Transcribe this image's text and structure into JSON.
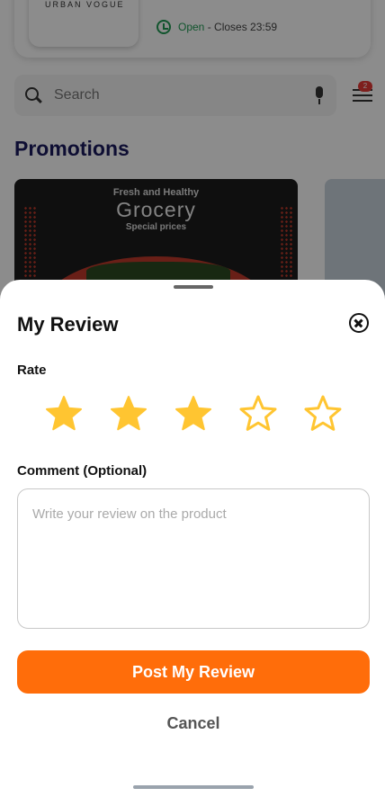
{
  "background": {
    "store": {
      "brand_text": "URBAN VOGUE",
      "hours_status": "Open",
      "hours_detail": " - Closes 23:59"
    },
    "search": {
      "placeholder": "Search",
      "filter_badge": "2"
    },
    "promotions": {
      "title": "Promotions",
      "card": {
        "top_line": "Fresh and Healthy",
        "headline": "Grocery",
        "subline": "Special prices"
      }
    }
  },
  "review_sheet": {
    "title": "My Review",
    "rate_label": "Rate",
    "rating": 3,
    "max_rating": 5,
    "star_fill_color": "#FFC531",
    "comment_label": "Comment (Optional)",
    "comment_placeholder": "Write your review on the product",
    "comment_value": "",
    "post_button_label": "Post My Review",
    "cancel_button_label": "Cancel"
  },
  "colors": {
    "accent": "#FF6D0A",
    "open_status": "#1F9A52",
    "title_navy": "#1A1A5E"
  }
}
